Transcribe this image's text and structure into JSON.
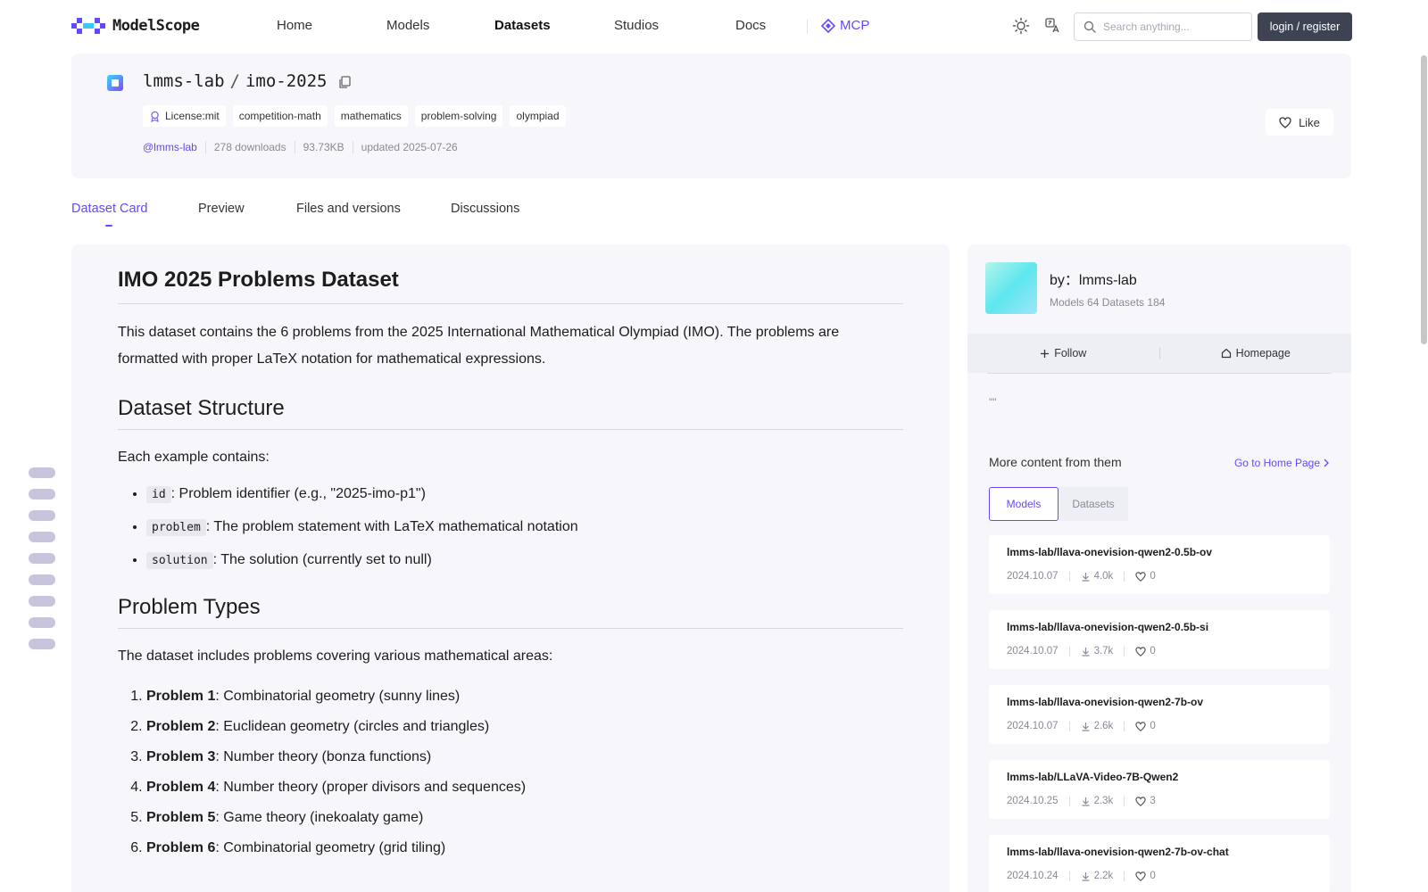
{
  "brand": {
    "name": "ModelScope",
    "accent": "#624aff"
  },
  "nav": {
    "items": [
      {
        "label": "Home",
        "active": false
      },
      {
        "label": "Models",
        "active": false
      },
      {
        "label": "Datasets",
        "active": true
      },
      {
        "label": "Studios",
        "active": false
      },
      {
        "label": "Docs",
        "active": false
      }
    ],
    "mcp_label": "MCP",
    "search_placeholder": "Search anything...",
    "login_label": "login / register"
  },
  "repo": {
    "owner": "lmms-lab",
    "name": "imo-2025",
    "tags": [
      "License:mit",
      "competition-math",
      "mathematics",
      "problem-solving",
      "olympiad"
    ],
    "meta": [
      "@lmms-lab",
      "278 downloads",
      "93.73KB",
      "updated 2025-07-26"
    ],
    "like_label": "Like"
  },
  "tabs": [
    "Dataset Card",
    "Preview",
    "Files and versions",
    "Discussions"
  ],
  "doc": {
    "title": "IMO 2025 Problems Dataset",
    "intro": "This dataset contains the 6 problems from the 2025 International Mathematical Olympiad (IMO). The problems are formatted with proper LaTeX notation for mathematical expressions.",
    "structure_heading": "Dataset Structure",
    "structure_intro": "Each example contains:",
    "fields": [
      {
        "code": "id",
        "desc": ": Problem identifier (e.g., \"2025-imo-p1\")"
      },
      {
        "code": "problem",
        "desc": ": The problem statement with LaTeX mathematical notation"
      },
      {
        "code": "solution",
        "desc": ": The solution (currently set to null)"
      }
    ],
    "types_heading": "Problem Types",
    "types_intro": "The dataset includes problems covering various mathematical areas:",
    "problems": [
      {
        "label": "Problem 1",
        "desc": ": Combinatorial geometry (sunny lines)"
      },
      {
        "label": "Problem 2",
        "desc": ": Euclidean geometry (circles and triangles)"
      },
      {
        "label": "Problem 3",
        "desc": ": Number theory (bonza functions)"
      },
      {
        "label": "Problem 4",
        "desc": ": Number theory (proper divisors and sequences)"
      },
      {
        "label": "Problem 5",
        "desc": ": Game theory (inekoalaty game)"
      },
      {
        "label": "Problem 6",
        "desc": ": Combinatorial geometry (grid tiling)"
      }
    ]
  },
  "sidebar": {
    "by_prefix": "by：",
    "org_name": "lmms-lab",
    "stats": "Models 64  Datasets 184",
    "follow_label": "Follow",
    "homepage_label": "Homepage",
    "quote": "\"\"",
    "more_title": "More content from them",
    "go_home_label": "Go to Home Page",
    "sub_tabs": [
      "Models",
      "Datasets"
    ],
    "models": [
      {
        "name": "lmms-lab/llava-onevision-qwen2-0.5b-ov",
        "date": "2024.10.07",
        "downloads": "4.0k",
        "likes": "0"
      },
      {
        "name": "lmms-lab/llava-onevision-qwen2-0.5b-si",
        "date": "2024.10.07",
        "downloads": "3.7k",
        "likes": "0"
      },
      {
        "name": "lmms-lab/llava-onevision-qwen2-7b-ov",
        "date": "2024.10.07",
        "downloads": "2.6k",
        "likes": "0"
      },
      {
        "name": "lmms-lab/LLaVA-Video-7B-Qwen2",
        "date": "2024.10.25",
        "downloads": "2.3k",
        "likes": "3"
      },
      {
        "name": "lmms-lab/llava-onevision-qwen2-7b-ov-chat",
        "date": "2024.10.24",
        "downloads": "2.2k",
        "likes": "0"
      }
    ]
  },
  "icons": {
    "theme": "sun-icon",
    "language": "translate-icon",
    "search": "search-icon",
    "copy": "copy-icon",
    "license": "badge-icon",
    "like": "heart-icon",
    "follow": "plus-icon",
    "homepage": "home-icon",
    "go_home": "chevron-right-icon",
    "download": "download-icon"
  }
}
